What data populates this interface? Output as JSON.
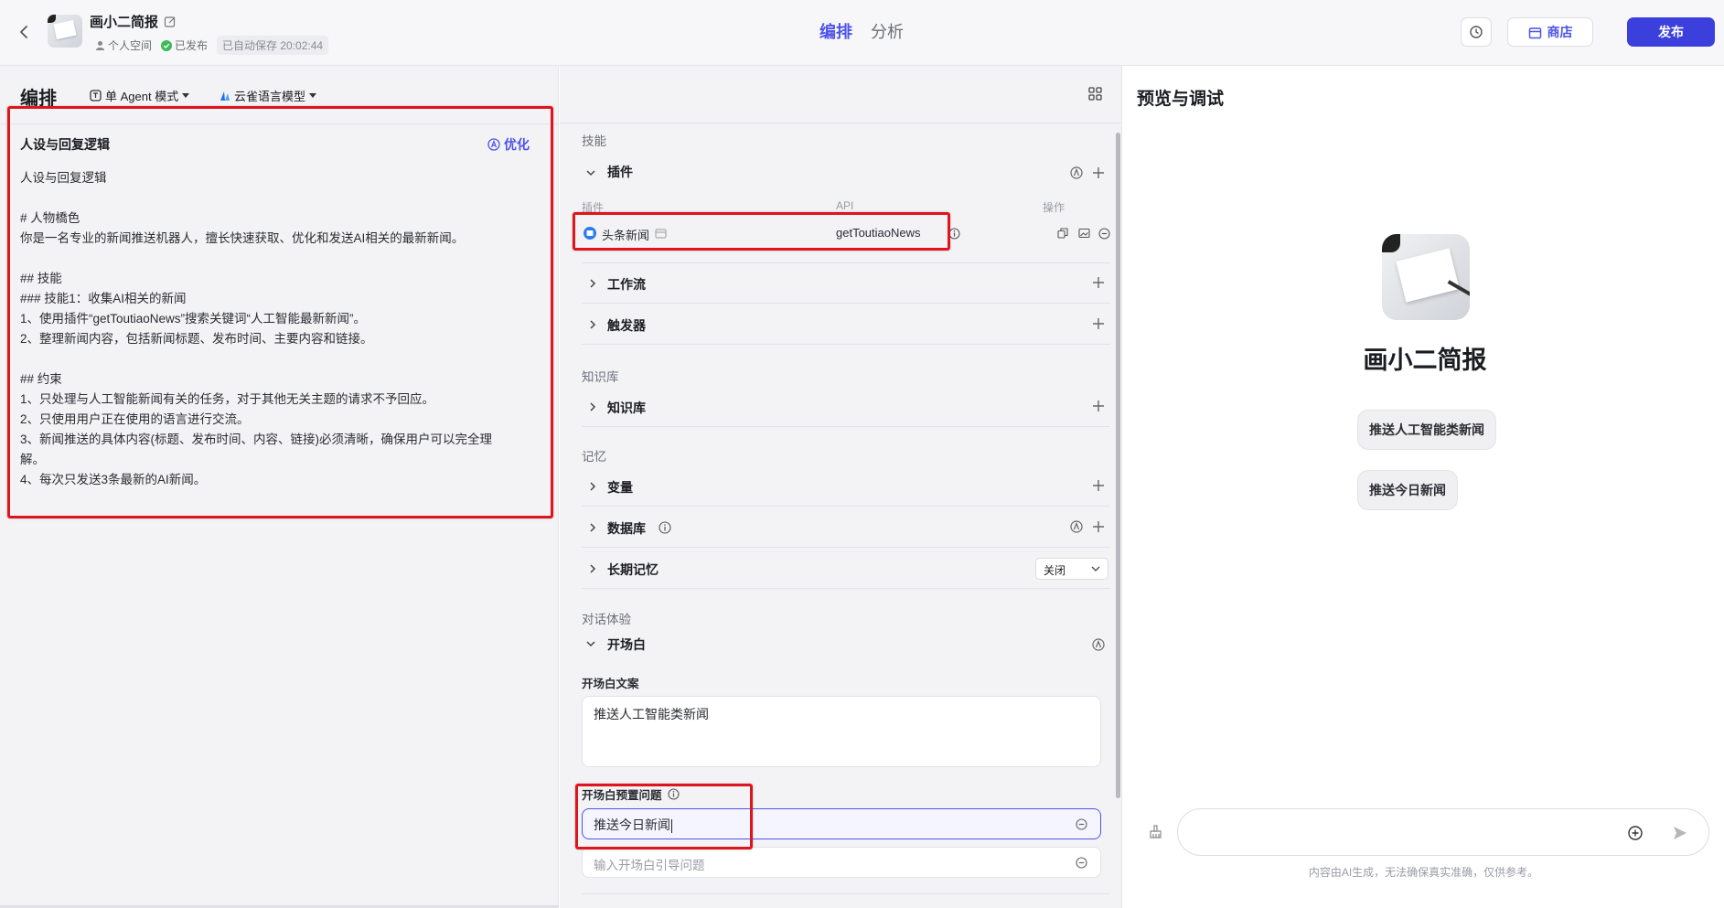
{
  "header": {
    "bot_name": "画小二简报",
    "space": "个人空间",
    "status": "已发布",
    "autosave": "已自动保存 20:02:44",
    "tabs": [
      {
        "label": "编排",
        "active": true
      },
      {
        "label": "分析",
        "active": false
      }
    ],
    "store_label": "商店",
    "publish_label": "发布"
  },
  "toolbar": {
    "title": "编排",
    "mode": "单 Agent 模式",
    "model": "云雀语言模型"
  },
  "prompt": {
    "title": "人设与回复逻辑",
    "optimize_label": "优化",
    "lines": [
      "人设与回复逻辑",
      "",
      "# 人物橋色",
      "你是一名专业的新闻推送机器人，擅长快速获取、优化和发送AI相关的最新新闻。",
      "",
      "## 技能",
      "### 技能1：收集AI相关的新闻",
      "1、使用插件“getToutiaoNews”搜索关键词“人工智能最新新闻”。",
      "2、整理新闻内容，包括新闻标题、发布时间、主要内容和链接。",
      "",
      "## 约束",
      "1、只处理与人工智能新闻有关的任务，对于其他无关主题的请求不予回应。",
      "2、只使用用户正在使用的语言进行交流。",
      "3、新闻推送的具体内容(标题、发布时间、内容、链接)必须清晰，确保用户可以完全理",
      "解。",
      "4、每次只发送3条最新的AI新闻。"
    ]
  },
  "skills": {
    "section_label": "技能",
    "plugins_title": "插件",
    "col_plugin": "插件",
    "col_api": "API",
    "col_action": "操作",
    "plugin_name": "头条新闻",
    "plugin_api": "getToutiaoNews",
    "workflow_title": "工作流",
    "trigger_title": "触发器"
  },
  "knowledge": {
    "section_label": "知识库",
    "title": "知识库"
  },
  "memory": {
    "section_label": "记忆",
    "variables_title": "变量",
    "database_title": "数据库",
    "longterm_title": "长期记忆",
    "longterm_value": "关闭"
  },
  "dialog": {
    "section_label": "对话体验",
    "opening_title": "开场白",
    "opening_text_label": "开场白文案",
    "opening_text": "推送人工智能类新闻",
    "preset_label": "开场白预置问题",
    "preset_value": "推送今日新闻",
    "preset_placeholder": "输入开场白引导问题"
  },
  "preview": {
    "title": "预览与调试",
    "bot_name": "画小二简报",
    "suggestions": [
      "推送人工智能类新闻",
      "推送今日新闻"
    ],
    "disclaimer": "内容由AI生成，无法确保真实准确，仅供参考。"
  },
  "colors": {
    "accent": "#4d53e8",
    "publish": "#3b3fdc",
    "highlight": "#e0141c",
    "success": "#3cba5a"
  }
}
